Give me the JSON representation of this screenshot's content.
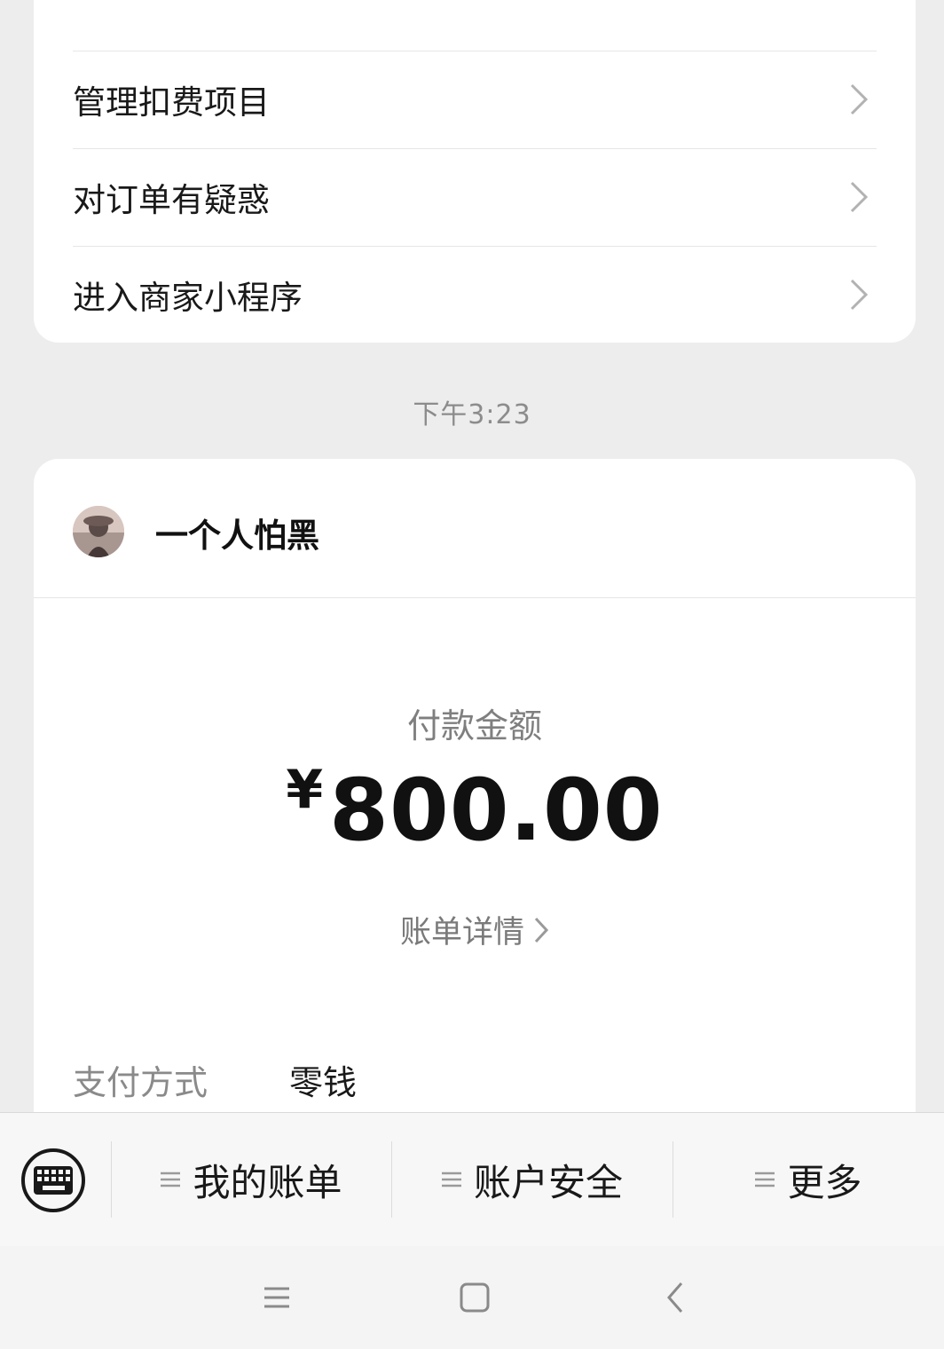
{
  "menu": {
    "items": [
      {
        "label": "管理扣费项目"
      },
      {
        "label": "对订单有疑惑"
      },
      {
        "label": "进入商家小程序"
      }
    ]
  },
  "timestamp": "下午3:23",
  "payment": {
    "sender_name": "一个人怕黑",
    "amount_label": "付款金额",
    "currency": "¥",
    "amount": "800.00",
    "detail_link": "账单详情",
    "method_label": "支付方式",
    "method_value": "零钱"
  },
  "toolbar": {
    "keyboard_icon": "keyboard-icon",
    "items": [
      {
        "label": "我的账单"
      },
      {
        "label": "账户安全"
      },
      {
        "label": "更多"
      }
    ]
  },
  "navbar": {
    "icons": [
      "menu-icon",
      "home-square-icon",
      "back-icon"
    ]
  }
}
